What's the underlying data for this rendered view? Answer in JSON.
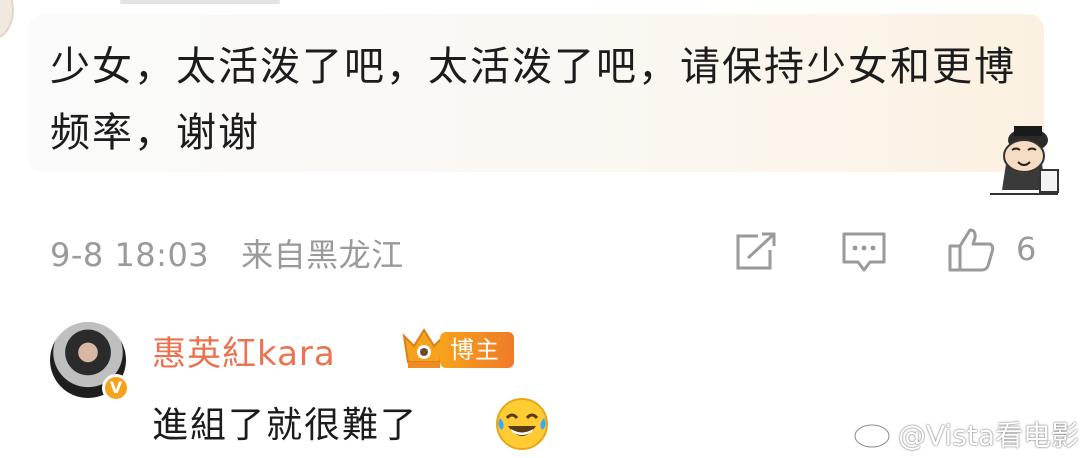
{
  "comment": {
    "text": "少女，太活泼了吧，太活泼了吧，请保持少女和更博频率，谢谢",
    "time": "9-8 18:03",
    "location": "来自黑龙江",
    "like_count": "6",
    "sticker_icon": "cartoon-scholar-sticker",
    "share_icon": "share-icon",
    "comment_icon": "comment-icon",
    "like_icon": "thumbs-up-icon"
  },
  "reply": {
    "username": "惠英紅kara",
    "badge_label": "博主",
    "verified_icon": "verified-v-icon",
    "crown_icon": "crown-icon",
    "text": "進組了就很難了",
    "emoji": "laugh-cry-emoji"
  },
  "watermark": {
    "text": "@Vista看电影"
  },
  "colors": {
    "username": "#eb7350",
    "meta_text": "#9a9a9a",
    "badge": "#f6a21d",
    "verified": "#f7a21b"
  }
}
